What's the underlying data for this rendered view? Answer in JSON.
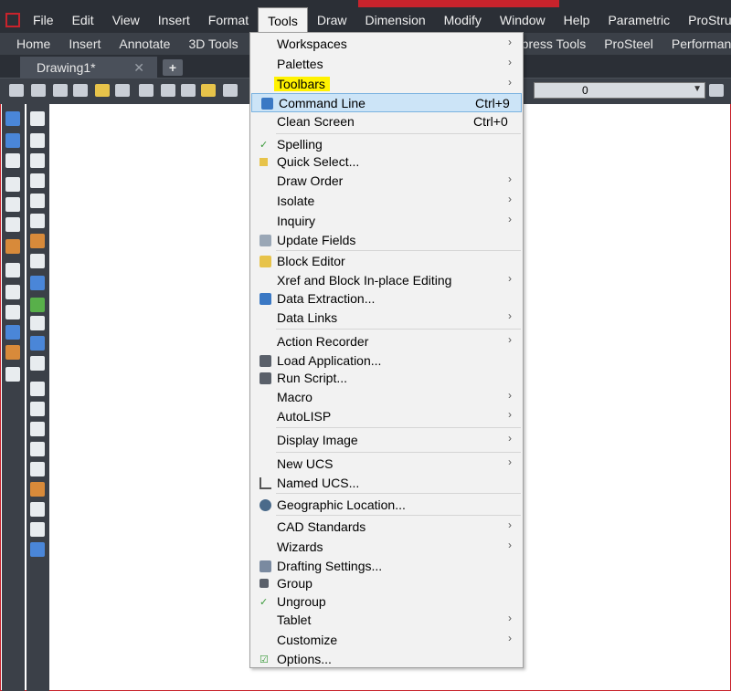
{
  "menubar": {
    "items": [
      "File",
      "Edit",
      "View",
      "Insert",
      "Format",
      "Tools",
      "Draw",
      "Dimension",
      "Modify",
      "Window",
      "Help",
      "Parametric",
      "ProStructure"
    ],
    "active_index": 5
  },
  "ribbon": {
    "tabs": [
      "Home",
      "Insert",
      "Annotate",
      "3D Tools",
      "press Tools",
      "ProSteel",
      "Performan"
    ]
  },
  "document_tab": {
    "title": "Drawing1*",
    "close_glyph": "✕",
    "new_tab_glyph": "+"
  },
  "layer_combo": {
    "value": "0"
  },
  "tools_menu": {
    "items": [
      {
        "label": "Workspaces",
        "submenu": true
      },
      {
        "label": "Palettes",
        "submenu": true
      },
      {
        "label": "Toolbars",
        "submenu": true,
        "highlighted_text": true
      },
      {
        "label": "Command Line",
        "shortcut": "Ctrl+9",
        "icon": "command-line-icon",
        "hovered": true
      },
      {
        "label": "Clean Screen",
        "shortcut": "Ctrl+0"
      },
      {
        "label": "Spelling",
        "icon": "spelling-check-icon"
      },
      {
        "label": "Quick Select...",
        "icon": "quick-select-icon"
      },
      {
        "label": "Draw Order",
        "submenu": true
      },
      {
        "label": "Isolate",
        "submenu": true
      },
      {
        "label": "Inquiry",
        "submenu": true
      },
      {
        "label": "Update Fields",
        "icon": "update-fields-icon"
      },
      {
        "label": "Block Editor",
        "icon": "block-editor-icon"
      },
      {
        "label": "Xref and Block In-place Editing",
        "submenu": true
      },
      {
        "label": "Data Extraction...",
        "icon": "data-extraction-icon"
      },
      {
        "label": "Data Links",
        "submenu": true
      },
      {
        "label": "Action Recorder",
        "submenu": true
      },
      {
        "label": "Load Application...",
        "icon": "load-application-icon"
      },
      {
        "label": "Run Script...",
        "icon": "run-script-icon"
      },
      {
        "label": "Macro",
        "submenu": true
      },
      {
        "label": "AutoLISP",
        "submenu": true
      },
      {
        "label": "Display Image",
        "submenu": true
      },
      {
        "label": "New UCS",
        "submenu": true
      },
      {
        "label": "Named UCS...",
        "icon": "named-ucs-icon"
      },
      {
        "label": "Geographic Location...",
        "icon": "globe-icon"
      },
      {
        "label": "CAD Standards",
        "submenu": true
      },
      {
        "label": "Wizards",
        "submenu": true
      },
      {
        "label": "Drafting Settings...",
        "icon": "drafting-settings-icon"
      },
      {
        "label": "Group",
        "icon": "group-icon"
      },
      {
        "label": "Ungroup",
        "icon": "ungroup-icon"
      },
      {
        "label": "Tablet",
        "submenu": true
      },
      {
        "label": "Customize",
        "submenu": true
      },
      {
        "label": "Options...",
        "icon": "options-icon"
      }
    ]
  },
  "colors": {
    "chrome_dark": "#2b2f36",
    "chrome_mid": "#3b4048",
    "menu_bg": "#f2f2f2",
    "hover_bg": "#cce4f7",
    "highlight_yellow": "#fff200",
    "accent_red": "#c8232c"
  }
}
